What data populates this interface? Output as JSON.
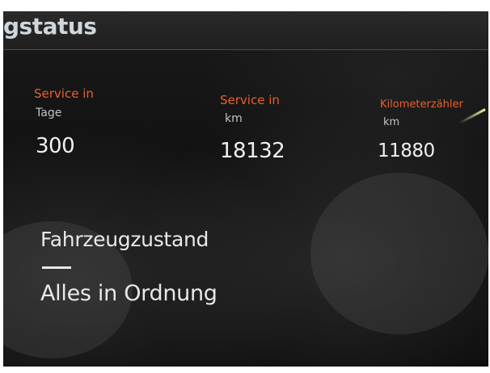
{
  "header": {
    "title": "gstatus"
  },
  "service_info": [
    {
      "label": "Service in",
      "unit": "Tage",
      "value": "300"
    },
    {
      "label": "Service in",
      "unit": "km",
      "value": "18132"
    },
    {
      "label": "Kilometerzähler",
      "unit": "km",
      "value": "11880"
    }
  ],
  "condition": {
    "title": "Fahrzeugzustand",
    "status": "Alles in Ordnung"
  },
  "colors": {
    "accent": "#e8602c",
    "text": "#eef0f2",
    "background": "#121212"
  }
}
